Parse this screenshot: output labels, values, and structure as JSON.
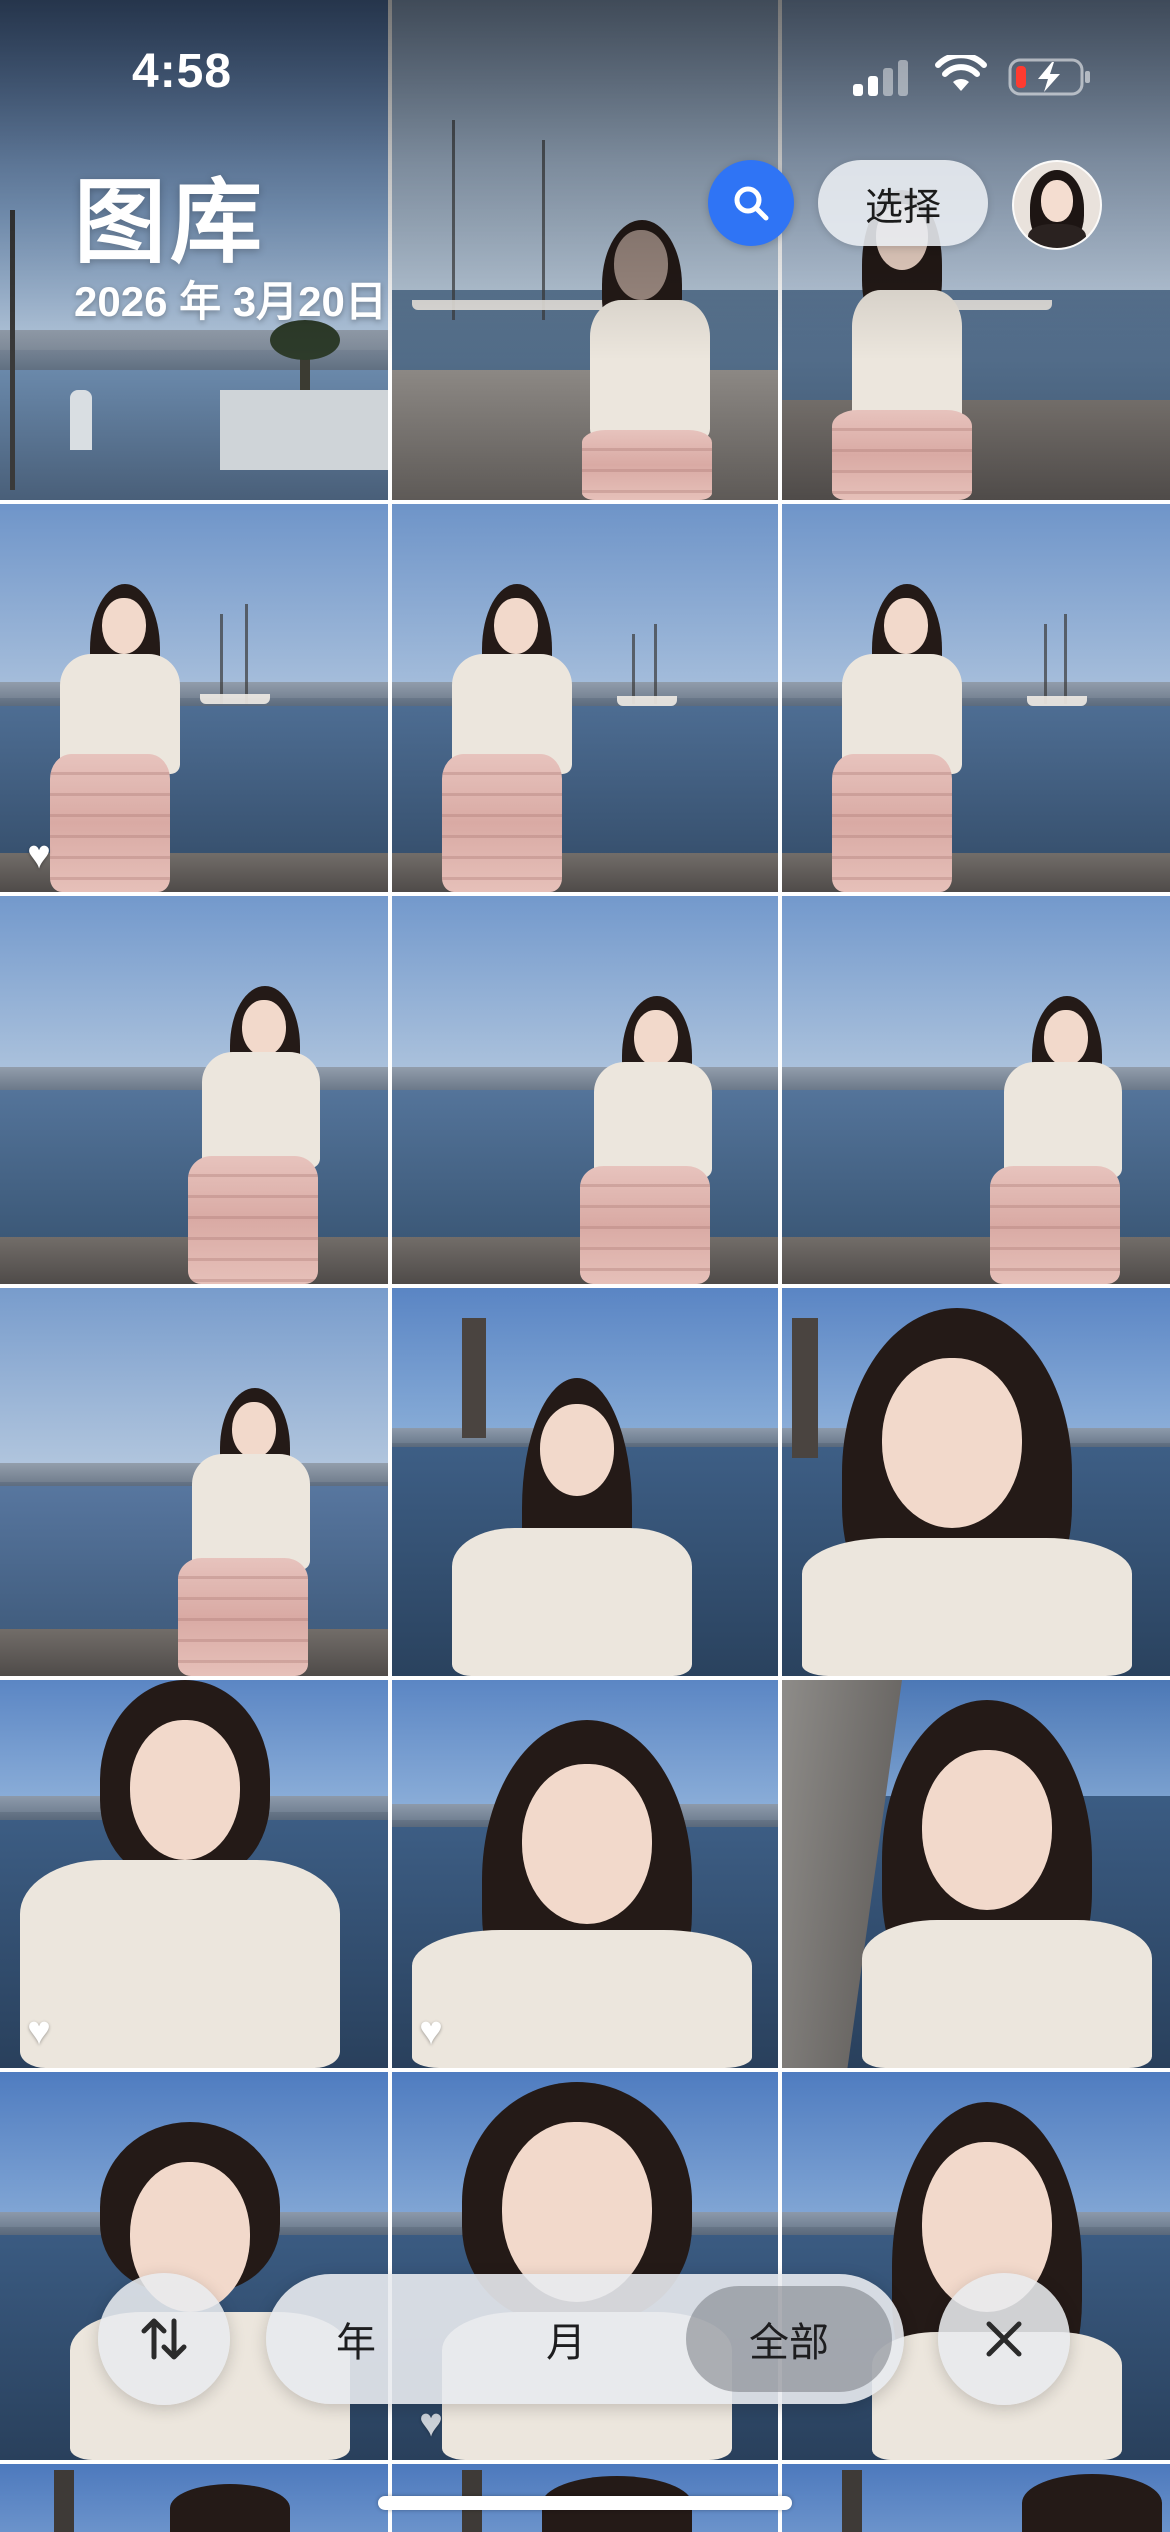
{
  "status_bar": {
    "time": "4:58"
  },
  "header": {
    "title": "图库",
    "date": "2026 年 3月20日",
    "select_label": "选择"
  },
  "bottom_bar": {
    "segments": [
      {
        "label": "年",
        "active": false
      },
      {
        "label": "月",
        "active": false
      },
      {
        "label": "全部",
        "active": true
      }
    ]
  },
  "icons": {
    "search": "search-icon",
    "sort": "sort-arrows-icon",
    "close": "close-icon",
    "favorite": "heart-icon",
    "signal": "cellular-signal-icon",
    "wifi": "wifi-icon",
    "battery": "battery-charging-icon"
  },
  "colors": {
    "accent_blue": "#2f74f5",
    "battery_low": "#ff3b30"
  }
}
